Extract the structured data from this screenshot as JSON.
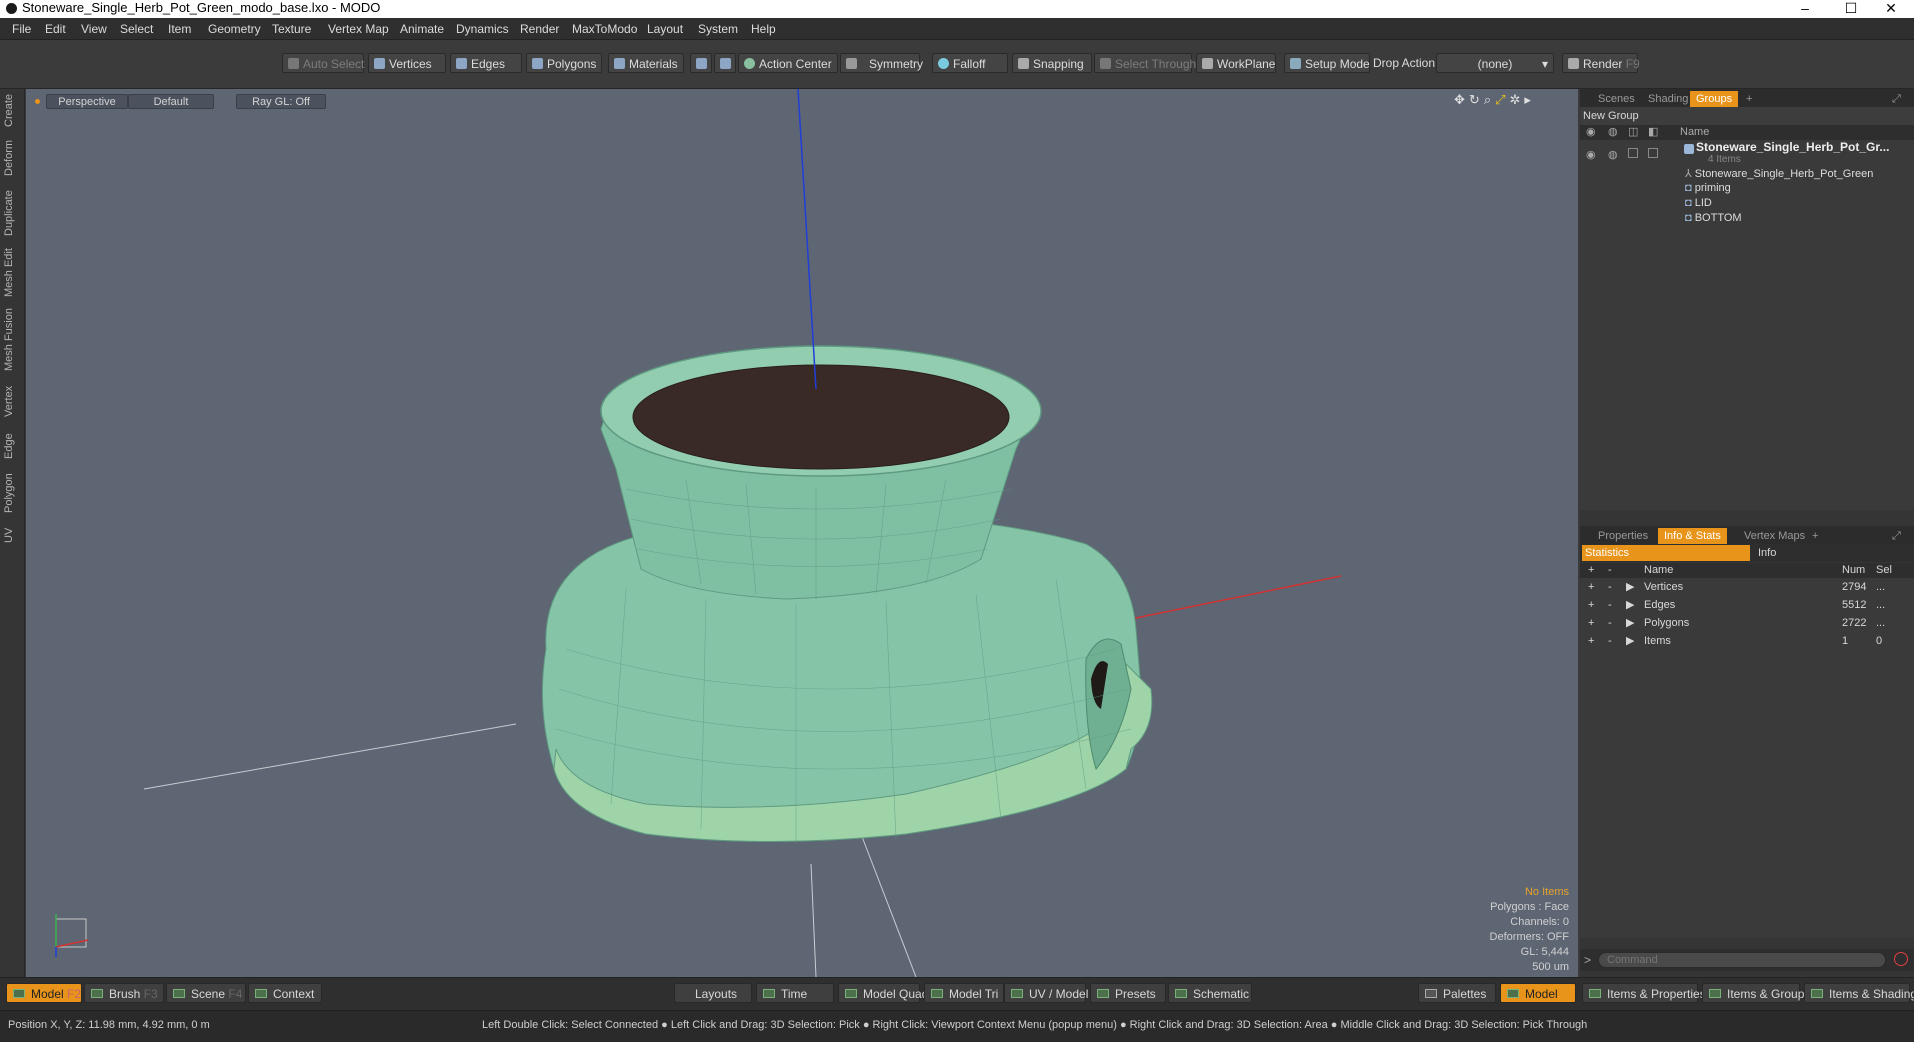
{
  "window": {
    "title": "Stoneware_Single_Herb_Pot_Green_modo_base.lxo - MODO",
    "minimize": "–",
    "maximize": "☐",
    "close": "✕"
  },
  "menu": [
    "File",
    "Edit",
    "View",
    "Select",
    "Item",
    "Geometry",
    "Texture",
    "Vertex Map",
    "Animate",
    "Dynamics",
    "Render",
    "MaxToModo",
    "Layout",
    "System",
    "Help"
  ],
  "toolbar": {
    "auto_select": "Auto Select",
    "vertices": "Vertices",
    "edges": "Edges",
    "polygons": "Polygons",
    "materials": "Materials",
    "action_center": "Action Center",
    "symmetry": "Symmetry",
    "falloff": "Falloff",
    "snapping": "Snapping",
    "select_through": "Select Through",
    "workplane": "WorkPlane",
    "setup_mode": "Setup Mode",
    "drop_action": "Drop Action",
    "drop_value": "(none)",
    "render": "Render",
    "render_key": "F9"
  },
  "left_tabs": [
    "Create",
    "Deform",
    "Duplicate",
    "Mesh Edit",
    "Mesh Fusion",
    "Vertex",
    "Edge",
    "Polygon",
    "UV"
  ],
  "viewport": {
    "view": "Perspective",
    "style": "Default",
    "raygl": "Ray GL: Off",
    "info": {
      "items": "No Items",
      "polygons": "Polygons : Face",
      "channels": "Channels: 0",
      "deformers": "Deformers: OFF",
      "gl": "GL: 5,444",
      "scale": "500 um"
    }
  },
  "scene_panel": {
    "tabs": [
      "Scenes",
      "Shading",
      "Groups"
    ],
    "active_tab": "Groups",
    "new_group": "New Group",
    "name_header": "Name",
    "group_name": "Stoneware_Single_Herb_Pot_Gr...",
    "group_count": "4 Items",
    "items": [
      "Stoneware_Single_Herb_Pot_Green",
      "priming",
      "LID",
      "BOTTOM"
    ]
  },
  "stats_panel": {
    "tabs": [
      "Properties",
      "Info & Stats",
      "Vertex Maps"
    ],
    "active_tab": "Info & Stats",
    "subtabs": [
      "Statistics",
      "Info"
    ],
    "headers": {
      "name": "Name",
      "num": "Num",
      "sel": "Sel"
    },
    "rows": [
      {
        "name": "Vertices",
        "num": "2794",
        "sel": "..."
      },
      {
        "name": "Edges",
        "num": "5512",
        "sel": "..."
      },
      {
        "name": "Polygons",
        "num": "2722",
        "sel": "..."
      },
      {
        "name": "Items",
        "num": "1",
        "sel": "0"
      }
    ],
    "command_placeholder": "Command"
  },
  "bottom": {
    "model": "Model",
    "model_key": "F2",
    "brush": "Brush",
    "brush_key": "F3",
    "scene": "Scene",
    "scene_key": "F4",
    "context": "Context",
    "layouts": "Layouts",
    "time": "Time",
    "model_quad": "Model Quad",
    "model_tri": "Model Tri",
    "uv_model": "UV / Model",
    "presets": "Presets",
    "schematic": "Schematic",
    "palettes": "Palettes",
    "model2": "Model",
    "items_props": "Items & Properties",
    "items_groups": "Items & Groups",
    "items_shading": "Items & Shading"
  },
  "status": {
    "position": "Position X, Y, Z:   11.98 mm, 4.92 mm, 0 m",
    "hints": "Left Double Click: Select Connected ● Left Click and Drag: 3D Selection: Pick ● Right Click: Viewport Context Menu (popup menu) ● Right Click and Drag: 3D Selection: Area ● Middle Click and Drag: 3D Selection: Pick Through"
  },
  "colors": {
    "accent": "#e8941a",
    "viewport_bg": "#5e6674",
    "pot": "#86c4a8",
    "soil": "#3a2a26"
  }
}
